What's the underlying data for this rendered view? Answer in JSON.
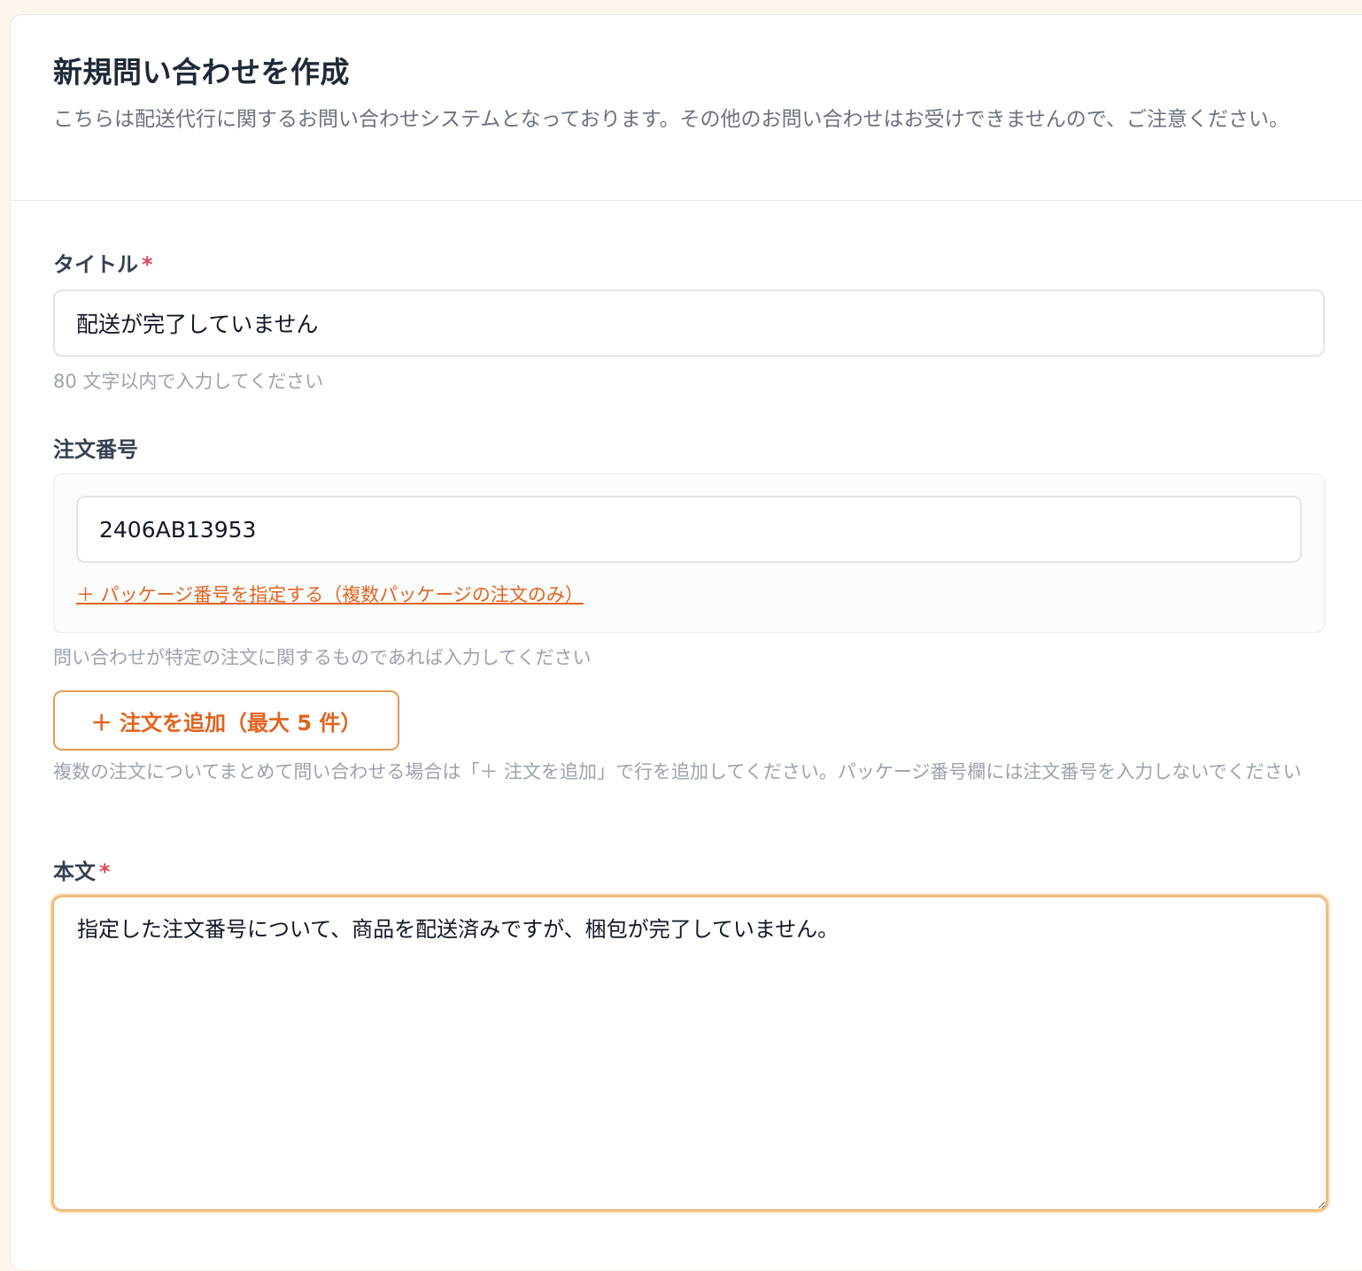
{
  "header": {
    "title": "新規問い合わせを作成",
    "description": "こちらは配送代行に関するお問い合わせシステムとなっております。その他のお問い合わせはお受けできませんので、ご注意ください。"
  },
  "form": {
    "title_field": {
      "label": "タイトル",
      "required_mark": "*",
      "value": "配送が完了していません",
      "help": "80 文字以内で入力してください"
    },
    "order_field": {
      "label": "注文番号",
      "value": "2406AB13953",
      "package_link": "＋ パッケージ番号を指定する（複数パッケージの注文のみ）",
      "help": "問い合わせが特定の注文に関するものであれば入力してください",
      "add_button": "＋ 注文を追加（最大 5 件）",
      "add_help": "複数の注文についてまとめて問い合わせる場合は「＋ 注文を追加」で行を追加してください。パッケージ番号欄には注文番号を入力しないでください"
    },
    "body_field": {
      "label": "本文",
      "required_mark": "*",
      "value": "指定した注文番号について、商品を配送済みですが、梱包が完了していません。"
    }
  },
  "colors": {
    "accent": "#e26420",
    "required": "#d9465a",
    "focus_border": "#f0bd80"
  }
}
